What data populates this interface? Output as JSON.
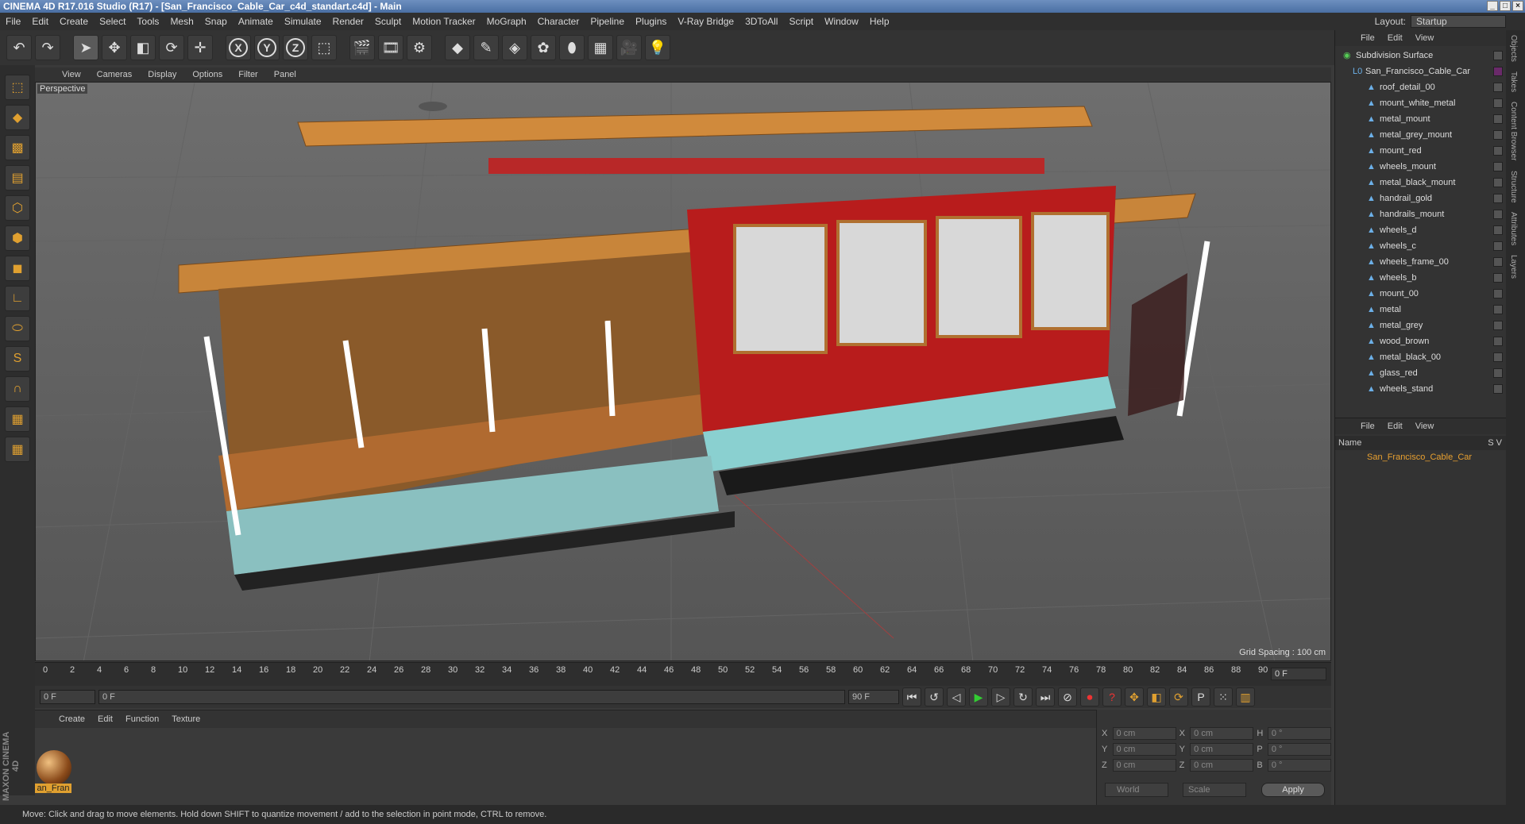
{
  "window": {
    "title": "CINEMA 4D R17.016 Studio (R17) - [San_Francisco_Cable_Car_c4d_standart.c4d] - Main"
  },
  "menu": [
    "File",
    "Edit",
    "Create",
    "Select",
    "Tools",
    "Mesh",
    "Snap",
    "Animate",
    "Simulate",
    "Render",
    "Sculpt",
    "Motion Tracker",
    "MoGraph",
    "Character",
    "Pipeline",
    "Plugins",
    "V-Ray Bridge",
    "3DToAll",
    "Script",
    "Window",
    "Help"
  ],
  "layout": {
    "label": "Layout:",
    "value": "Startup"
  },
  "viewport": {
    "menu": [
      "View",
      "Cameras",
      "Display",
      "Options",
      "Filter",
      "Panel"
    ],
    "label": "Perspective",
    "grid": "Grid Spacing : 100 cm"
  },
  "timeline": {
    "ticks": [
      "0",
      "2",
      "4",
      "6",
      "8",
      "10",
      "12",
      "14",
      "16",
      "18",
      "20",
      "22",
      "24",
      "26",
      "28",
      "30",
      "32",
      "34",
      "36",
      "38",
      "40",
      "42",
      "44",
      "46",
      "48",
      "50",
      "52",
      "54",
      "56",
      "58",
      "60",
      "62",
      "64",
      "66",
      "68",
      "70",
      "72",
      "74",
      "76",
      "78",
      "80",
      "82",
      "84",
      "86",
      "88",
      "90"
    ],
    "current": "0 F"
  },
  "transport": {
    "start": "0 F",
    "range_start": "0 F",
    "range_end": "90 F",
    "end": "90 F"
  },
  "material": {
    "menu": [
      "Create",
      "Edit",
      "Function",
      "Texture"
    ],
    "name": "an_Fran"
  },
  "coords": {
    "x": "0 cm",
    "y": "0 cm",
    "z": "0 cm",
    "sx": "0 cm",
    "sy": "0 cm",
    "sz": "0 cm",
    "h": "0 °",
    "p": "0 °",
    "b": "0 °",
    "world": "World",
    "scale": "Scale",
    "apply": "Apply"
  },
  "status": "Move: Click and drag to move elements. Hold down SHIFT to quantize movement / add to the selection in point mode, CTRL to remove.",
  "objects": {
    "menu": [
      "File",
      "Edit",
      "View"
    ],
    "items": [
      "Subdivision Surface",
      "San_Francisco_Cable_Car",
      "roof_detail_00",
      "mount_white_metal",
      "metal_mount",
      "metal_grey_mount",
      "mount_red",
      "wheels_mount",
      "metal_black_mount",
      "handrail_gold",
      "handrails_mount",
      "wheels_d",
      "wheels_c",
      "wheels_frame_00",
      "wheels_b",
      "mount_00",
      "metal",
      "metal_grey",
      "wood_brown",
      "metal_black_00",
      "glass_red",
      "wheels_stand"
    ]
  },
  "layers": {
    "menu": [
      "File",
      "Edit",
      "View"
    ],
    "header": "Name",
    "header_sv": "S  V",
    "item": "San_Francisco_Cable_Car"
  },
  "sidetabs": [
    "Objects",
    "Takes",
    "Content Browser",
    "Structure",
    "Attributes",
    "Layers"
  ],
  "brand": "MAXON CINEMA 4D"
}
